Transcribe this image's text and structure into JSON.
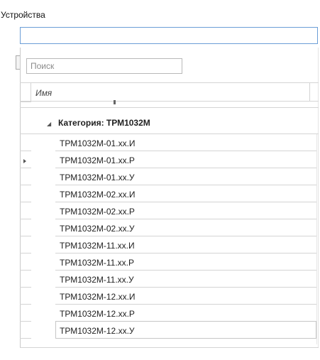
{
  "form": {
    "devices_label": "Устройства",
    "device_value": ""
  },
  "search": {
    "placeholder": "Поиск"
  },
  "grid": {
    "column_name": "Имя",
    "group_label": "Категория: ТРМ1032М",
    "rows": [
      "ТРМ1032М-01.xx.И",
      "ТРМ1032М-01.xx.Р",
      "ТРМ1032М-01.xx.У",
      "ТРМ1032М-02.xx.И",
      "ТРМ1032М-02.xx.Р",
      "ТРМ1032М-02.xx.У",
      "ТРМ1032М-11.xx.И",
      "ТРМ1032М-11.xx.Р",
      "ТРМ1032М-11.xx.У",
      "ТРМ1032М-12.xx.И",
      "ТРМ1032М-12.xx.Р",
      "ТРМ1032М-12.xx.У"
    ]
  }
}
